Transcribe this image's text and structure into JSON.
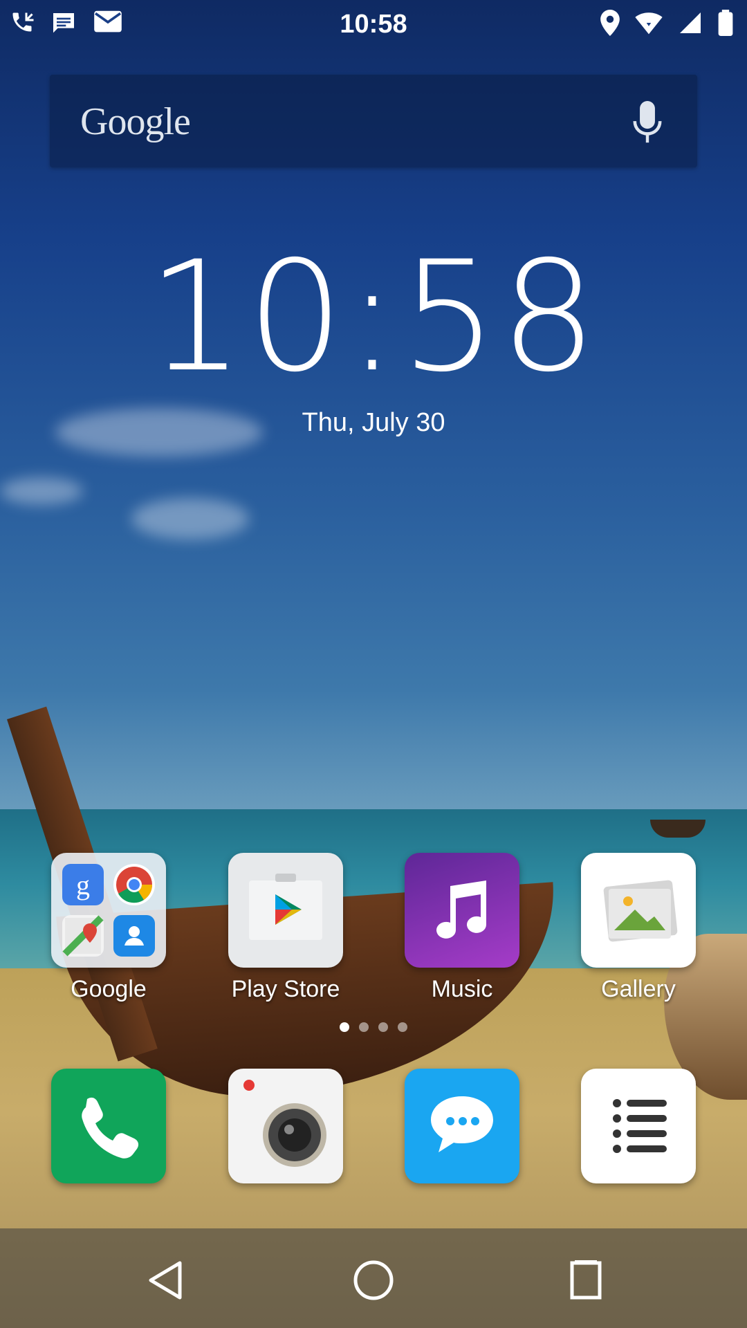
{
  "status_bar": {
    "time": "10:58",
    "left_icons": [
      "missed-call-icon",
      "message-icon",
      "email-icon"
    ],
    "right_icons": [
      "location-icon",
      "wifi-icon",
      "signal-icon",
      "battery-icon"
    ]
  },
  "search": {
    "logo_text": "Google",
    "mic_icon": "mic-icon"
  },
  "clock_widget": {
    "time": "10:58",
    "date": "Thu, July 30"
  },
  "apps_row": [
    {
      "label": "Google",
      "icon": "google-folder-icon"
    },
    {
      "label": "Play Store",
      "icon": "play-store-icon"
    },
    {
      "label": "Music",
      "icon": "music-icon"
    },
    {
      "label": "Gallery",
      "icon": "gallery-icon"
    }
  ],
  "page_indicator": {
    "count": 4,
    "active": 1
  },
  "dock": [
    {
      "icon": "phone-icon"
    },
    {
      "icon": "camera-icon"
    },
    {
      "icon": "messaging-icon"
    },
    {
      "icon": "list-icon"
    }
  ],
  "nav": {
    "back": "back-icon",
    "home": "home-icon",
    "recents": "recents-icon"
  },
  "colors": {
    "phone": "#10a55a",
    "messaging": "#1aa6f1",
    "music_start": "#6a2aa0",
    "music_end": "#a33cc8"
  }
}
